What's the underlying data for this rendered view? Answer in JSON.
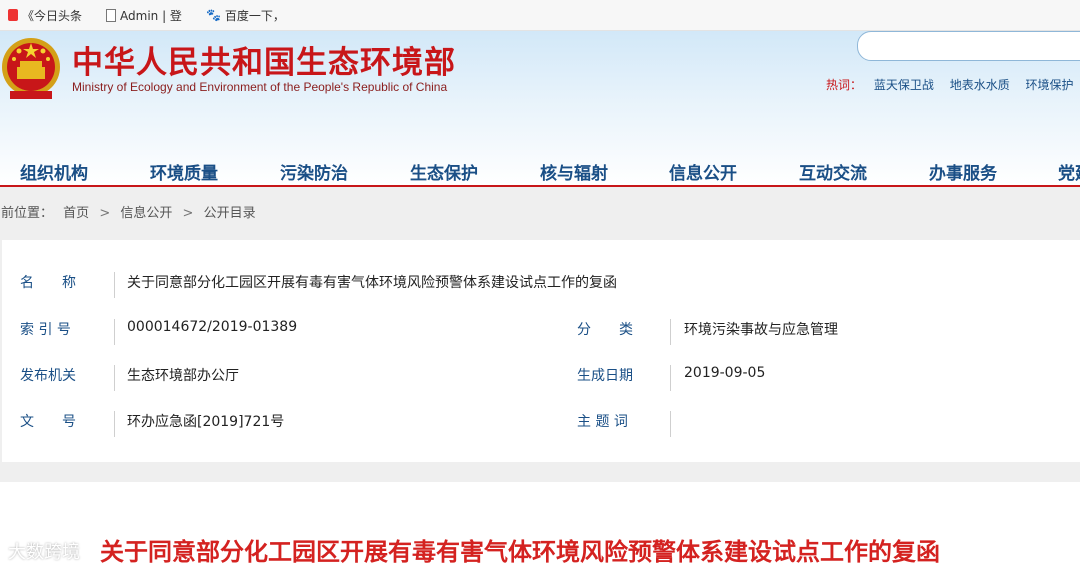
{
  "bookmarks": [
    {
      "label": "《今日头条",
      "icon": "toutiao-icon"
    },
    {
      "label": "Admin | 登",
      "icon": "page-icon"
    },
    {
      "label": "百度一下，",
      "icon": "baidu-paw-icon"
    }
  ],
  "header": {
    "site_name_cn": "中华人民共和国生态环境部",
    "site_name_en": "Ministry of Ecology and Environment of the People's Republic of China",
    "hot_label": "热词：",
    "hot_words": [
      "蓝天保卫战",
      "地表水水质",
      "环境保护"
    ]
  },
  "nav": [
    "组织机构",
    "环境质量",
    "污染防治",
    "生态保护",
    "核与辐射",
    "信息公开",
    "互动交流",
    "办事服务",
    "党建"
  ],
  "breadcrumb": {
    "prefix": "当前位置：",
    "items": [
      "首页",
      "信息公开",
      "公开目录"
    ],
    "separator": ">"
  },
  "info": {
    "name_label": "名　　称",
    "name_value": "关于同意部分化工园区开展有毒有害气体环境风险预警体系建设试点工作的复函",
    "index_label": "索 引 号",
    "index_value": "000014672/2019-01389",
    "category_label": "分　　类",
    "category_value": "环境污染事故与应急管理",
    "issuer_label": "发布机关",
    "issuer_value": "生态环境部办公厅",
    "date_label": "生成日期",
    "date_value": "2019-09-05",
    "docno_label": "文　　号",
    "docno_value": "环办应急函[2019]721号",
    "keywords_label": "主 题 词",
    "keywords_value": ""
  },
  "document": {
    "title": "关于同意部分化工园区开展有毒有害气体环境风险预警体系建设试点工作的复函"
  },
  "watermark": "大数跨境",
  "colors": {
    "brand_red": "#c81619",
    "nav_blue": "#1a4f86"
  }
}
